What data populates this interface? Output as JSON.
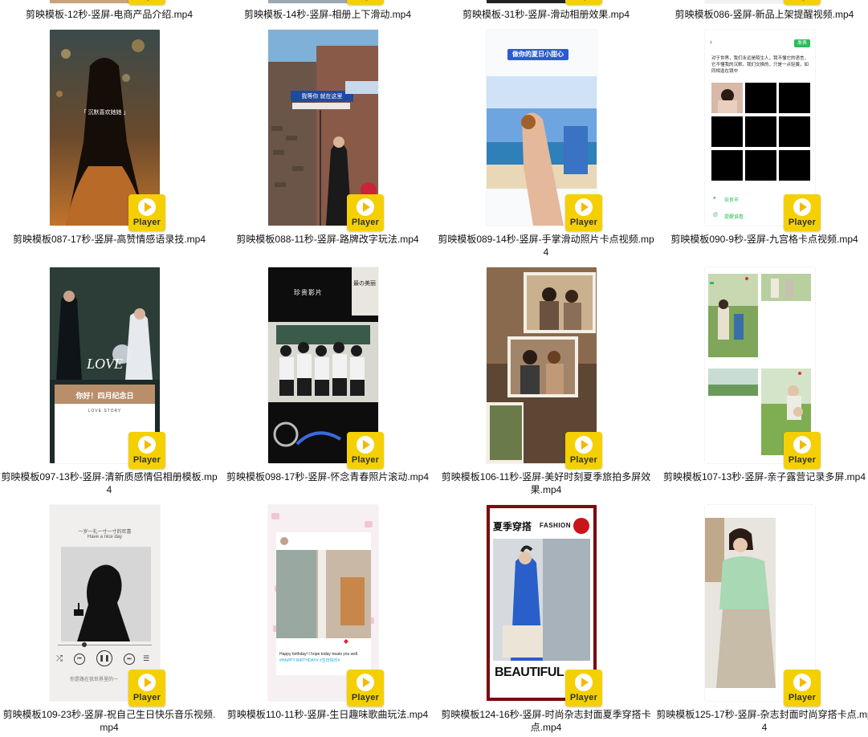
{
  "player_label": "Player",
  "top_row": [
    {
      "caption": "剪映模板-12秒-竖屏-电商产品介绍.mp4"
    },
    {
      "caption": "剪映模板-14秒-竖屏-相册上下滑动.mp4"
    },
    {
      "caption": "剪映模板-31秒-竖屏-滑动相册效果.mp4"
    },
    {
      "caption": "剪映模板086-竖屏-新品上架提醒视频.mp4"
    }
  ],
  "rows": [
    [
      {
        "caption": "剪映模板087-17秒-竖屏-高赞情感语录技.mp4",
        "thumb_text": "「 沉默喜欢她她 」",
        "thumb": "night-girl"
      },
      {
        "caption": "剪映模板088-11秒-竖屏-路牌改字玩法.mp4",
        "thumb_text": "我等你 就在这里",
        "thumb": "street-sign"
      },
      {
        "caption": "剪映模板089-14秒-竖屏-手掌滑动照片卡点视频.mp4",
        "thumb_text": "做你的夏日小甜心",
        "thumb": "beach-hand"
      },
      {
        "caption": "剪映模板090-9秒-竖屏-九宫格卡点视频.mp4",
        "thumb_text": "对于世界，我们永远是陌生人，我不懂它的语言，它不懂我的沉默。我们交换的，只是一点轻蔑，如同相逢在镜中",
        "thumb": "nine-grid",
        "thumb_button": "发表",
        "thumb_location": "奈良市",
        "thumb_link": "提醒谁看"
      }
    ],
    [
      {
        "caption": "剪映模板097-13秒-竖屏-清新质感情侣相册模板.mp4",
        "thumb_text": "你好！四月纪念日",
        "thumb_sub": "LOVE STORY",
        "thumb_big": "LOVE",
        "thumb": "love-story"
      },
      {
        "caption": "剪映模板098-17秒-竖屏-怀念青春照片滚动.mp4",
        "thumb_text": "珍贵影片",
        "thumb_side": "最の美丽",
        "thumb": "school-film"
      },
      {
        "caption": "剪映模板106-11秒-竖屏-美好时刻夏季旅拍多屏效果.mp4",
        "thumb": "polaroid"
      },
      {
        "caption": "剪映模板107-13秒-竖屏-亲子露营记录多屏.mp4",
        "thumb": "family-camp"
      }
    ],
    [
      {
        "caption": "剪映模板109-23秒-竖屏-祝自己生日快乐音乐视频.mp4",
        "thumb_text": "一岁一礼一寸一寸的欢喜",
        "thumb_sub": "Have a nice day",
        "thumb_footer": "你是路在我世界里的一",
        "thumb": "birthday-music"
      },
      {
        "caption": "剪映模板110-11秒-竖屏-生日趣味歌曲玩法.mp4",
        "thumb_text": "Happy birthday! I hope today treats you well.",
        "thumb_sub": "#HAPPY BIRTHDAY# #生日快乐#",
        "thumb": "birthday-post"
      },
      {
        "caption": "剪映模板124-16秒-竖屏-时尚杂志封面夏季穿搭卡点.mp4",
        "thumb_text": "夏季穿搭",
        "thumb_sub": "FASHION",
        "thumb_big": "BEAUTIFUL",
        "thumb": "fashion-cover"
      },
      {
        "caption": "剪映模板125-17秒-竖屏-杂志封面时尚穿搭卡点.mp4",
        "thumb": "magazine-green"
      }
    ]
  ],
  "colors": {
    "badge": "#f5d000",
    "accent_green": "#2bbd5a"
  }
}
